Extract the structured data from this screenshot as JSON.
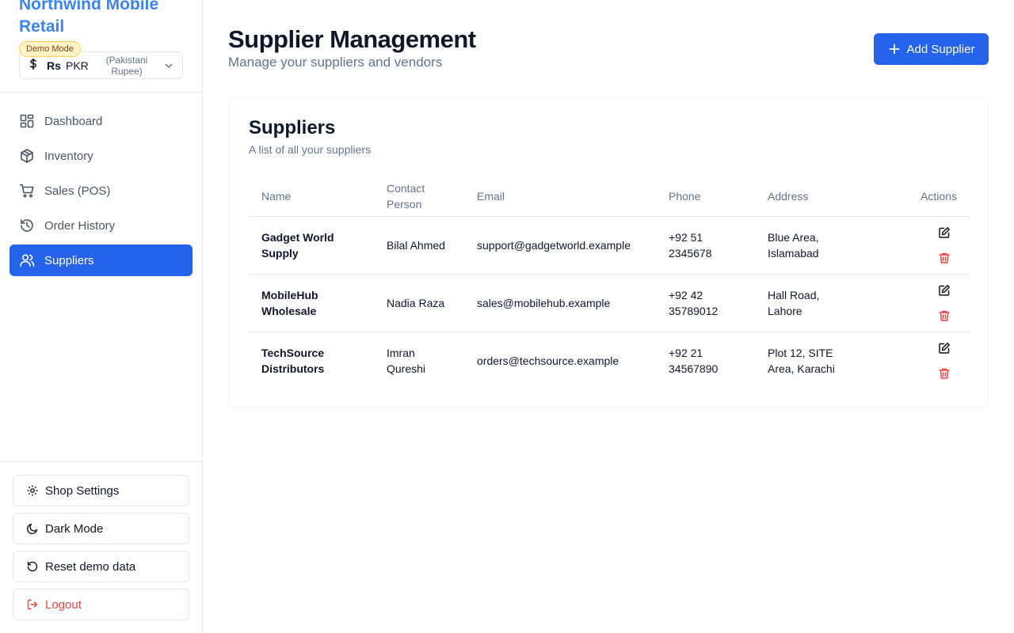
{
  "sidebar": {
    "brand": "Northwind Mobile Retail",
    "demo_badge": "Demo Mode",
    "currency": {
      "symbol": "Rs",
      "code": "PKR",
      "name": "(Pakistani Rupee)"
    },
    "nav": [
      {
        "label": "Dashboard",
        "icon": "dashboard-icon"
      },
      {
        "label": "Inventory",
        "icon": "package-icon"
      },
      {
        "label": "Sales (POS)",
        "icon": "cart-icon"
      },
      {
        "label": "Order History",
        "icon": "history-icon"
      },
      {
        "label": "Suppliers",
        "icon": "users-icon",
        "active": true
      }
    ],
    "actions": {
      "settings": "Shop Settings",
      "dark_mode": "Dark Mode",
      "reset": "Reset demo data",
      "logout": "Logout"
    }
  },
  "header": {
    "title": "Supplier Management",
    "subtitle": "Manage your suppliers and vendors",
    "add_button": "Add Supplier"
  },
  "card": {
    "title": "Suppliers",
    "subtitle": "A list of all your suppliers",
    "columns": [
      "Name",
      "Contact Person",
      "Email",
      "Phone",
      "Address",
      "Actions"
    ],
    "rows": [
      {
        "name": "Gadget World Supply",
        "contact": "Bilal Ahmed",
        "email": "support@gadgetworld.example",
        "phone": "+92 51 2345678",
        "address": "Blue Area, Islamabad"
      },
      {
        "name": "MobileHub Wholesale",
        "contact": "Nadia Raza",
        "email": "sales@mobilehub.example",
        "phone": "+92 42 35789012",
        "address": "Hall Road, Lahore"
      },
      {
        "name": "TechSource Distributors",
        "contact": "Imran Qureshi",
        "email": "orders@techsource.example",
        "phone": "+92 21 34567890",
        "address": "Plot 12, SITE Area, Karachi"
      }
    ]
  },
  "colors": {
    "primary": "#2563eb",
    "brand": "#3b82f6",
    "danger": "#ef4444",
    "muted": "#64748b"
  }
}
